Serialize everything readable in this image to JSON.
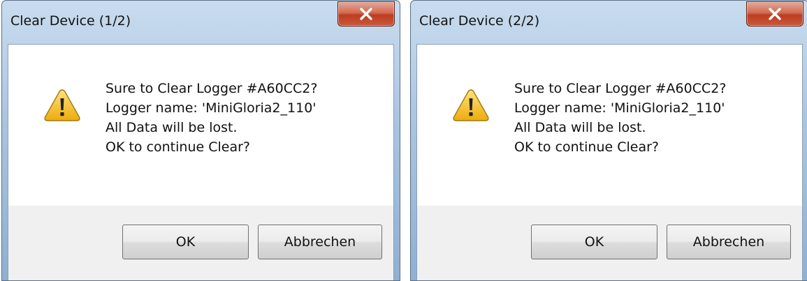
{
  "dialogs": [
    {
      "title": "Clear Device (1/2)",
      "message_lines": [
        "Sure to Clear Logger #A60CC2?",
        "Logger name: 'MiniGloria2_110'",
        "All Data will be lost.",
        "OK to continue Clear?"
      ],
      "ok_label": "OK",
      "cancel_label": "Abbrechen",
      "icon": "warning-icon",
      "close_icon": "close-icon"
    },
    {
      "title": "Clear Device (2/2)",
      "message_lines": [
        "Sure to Clear Logger #A60CC2?",
        "Logger name: 'MiniGloria2_110'",
        "All Data will be lost.",
        "OK to continue Clear?"
      ],
      "ok_label": "OK",
      "cancel_label": "Abbrechen",
      "icon": "warning-icon",
      "close_icon": "close-icon"
    }
  ],
  "colors": {
    "titlebar": "#b9cfe7",
    "close_button": "#c94b2e",
    "content": "#ffffff",
    "button_area": "#f0f0f0",
    "warning_fill": "#f6c619"
  }
}
